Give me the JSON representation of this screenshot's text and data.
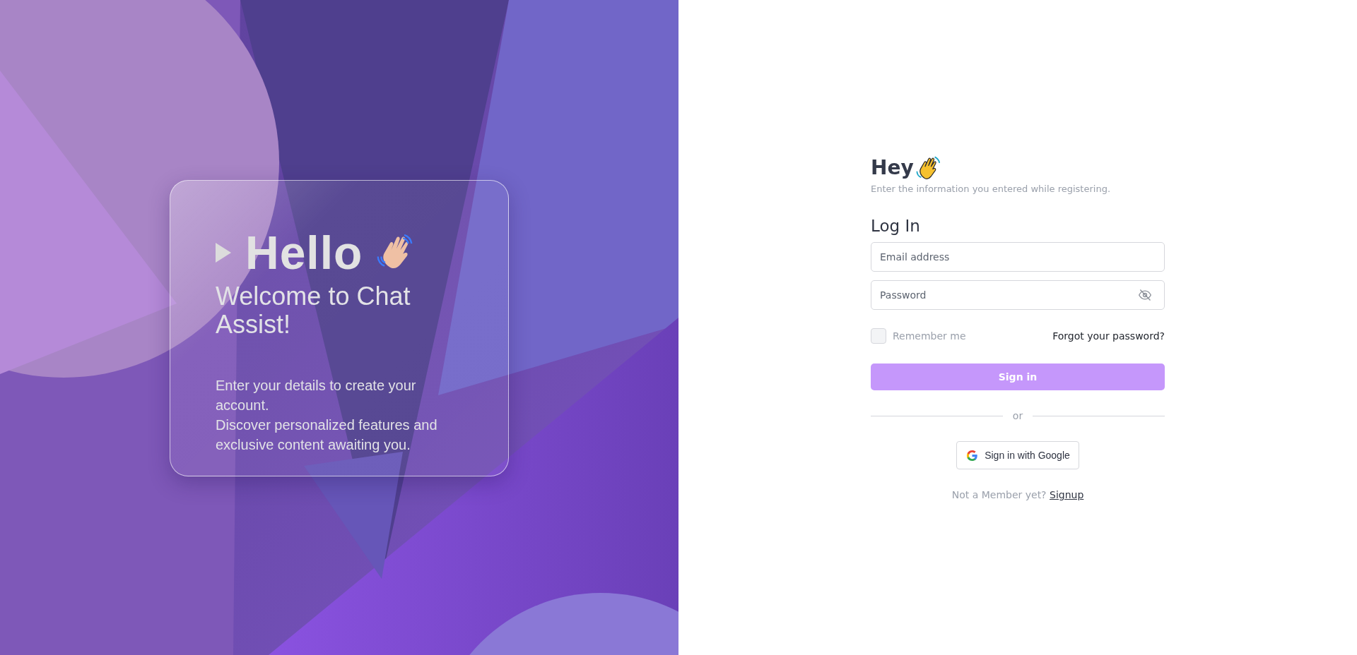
{
  "hero": {
    "title": "Hello",
    "subtitle": "Welcome to Chat Assist!",
    "description": [
      "Enter your details to create your account.",
      "Discover personalized features and exclusive content awaiting you."
    ]
  },
  "login": {
    "greeting": "Hey",
    "hint": "Enter the information you entered while registering.",
    "heading": "Log In",
    "email": {
      "placeholder": "Email address"
    },
    "password": {
      "placeholder": "Password",
      "visible": false
    },
    "remember": {
      "label": "Remember me",
      "checked": false
    },
    "forgot": "Forgot your password?",
    "submit": "Sign in",
    "divider": "or",
    "google": "Sign in with Google",
    "signup": {
      "prompt": "Not a Member yet?",
      "link": "Signup"
    }
  }
}
